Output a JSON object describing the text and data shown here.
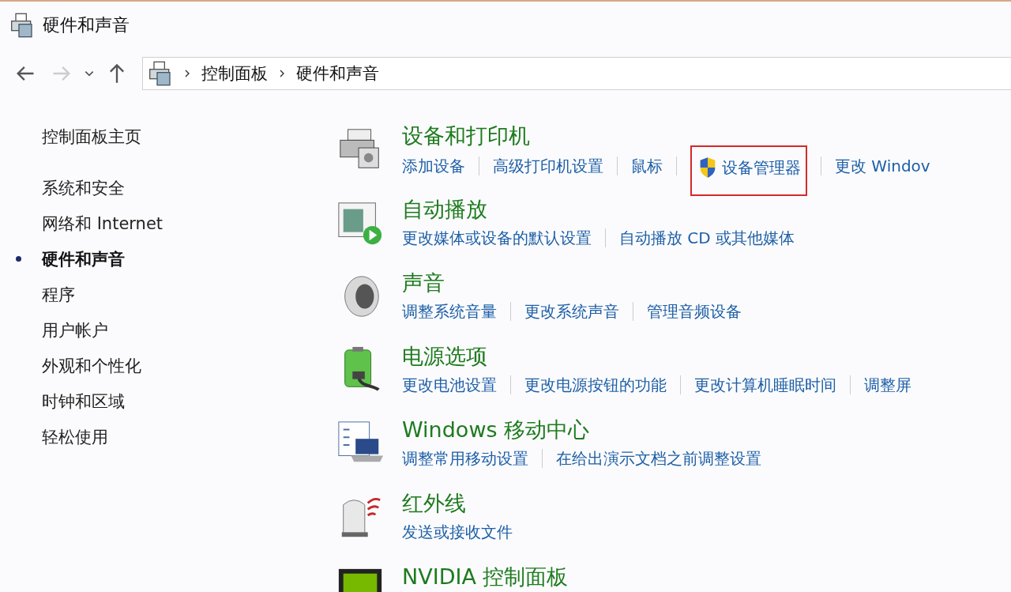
{
  "window": {
    "title": "硬件和声音"
  },
  "address_bar": {
    "path": [
      "控制面板",
      "硬件和声音"
    ]
  },
  "sidebar": {
    "items": [
      {
        "label": "控制面板主页",
        "selected": false
      },
      {
        "label": "系统和安全",
        "selected": false
      },
      {
        "label": "网络和 Internet",
        "selected": false
      },
      {
        "label": "硬件和声音",
        "selected": true
      },
      {
        "label": "程序",
        "selected": false
      },
      {
        "label": "用户帐户",
        "selected": false
      },
      {
        "label": "外观和个性化",
        "selected": false
      },
      {
        "label": "时钟和区域",
        "selected": false
      },
      {
        "label": "轻松使用",
        "selected": false
      }
    ]
  },
  "categories": [
    {
      "kind": "printer",
      "title": "设备和打印机",
      "links": [
        {
          "label": "添加设备",
          "shield": false,
          "highlighted": false
        },
        {
          "label": "高级打印机设置",
          "shield": false,
          "highlighted": false
        },
        {
          "label": "鼠标",
          "shield": false,
          "highlighted": false
        },
        {
          "label": "设备管理器",
          "shield": true,
          "highlighted": true
        },
        {
          "label": "更改 Windov",
          "shield": false,
          "highlighted": false
        }
      ]
    },
    {
      "kind": "autoplay",
      "title": "自动播放",
      "links": [
        {
          "label": "更改媒体或设备的默认设置",
          "shield": false,
          "highlighted": false
        },
        {
          "label": "自动播放 CD 或其他媒体",
          "shield": false,
          "highlighted": false
        }
      ]
    },
    {
      "kind": "sound",
      "title": "声音",
      "links": [
        {
          "label": "调整系统音量",
          "shield": false,
          "highlighted": false
        },
        {
          "label": "更改系统声音",
          "shield": false,
          "highlighted": false
        },
        {
          "label": "管理音频设备",
          "shield": false,
          "highlighted": false
        }
      ]
    },
    {
      "kind": "power",
      "title": "电源选项",
      "links": [
        {
          "label": "更改电池设置",
          "shield": false,
          "highlighted": false
        },
        {
          "label": "更改电源按钮的功能",
          "shield": false,
          "highlighted": false
        },
        {
          "label": "更改计算机睡眠时间",
          "shield": false,
          "highlighted": false
        },
        {
          "label": "调整屏",
          "shield": false,
          "highlighted": false
        }
      ]
    },
    {
      "kind": "mobility",
      "title": "Windows 移动中心",
      "links": [
        {
          "label": "调整常用移动设置",
          "shield": false,
          "highlighted": false
        },
        {
          "label": "在给出演示文档之前调整设置",
          "shield": false,
          "highlighted": false
        }
      ]
    },
    {
      "kind": "infrared",
      "title": "红外线",
      "links": [
        {
          "label": "发送或接收文件",
          "shield": false,
          "highlighted": false
        }
      ]
    },
    {
      "kind": "nvidia",
      "title": "NVIDIA 控制面板"
    }
  ]
}
